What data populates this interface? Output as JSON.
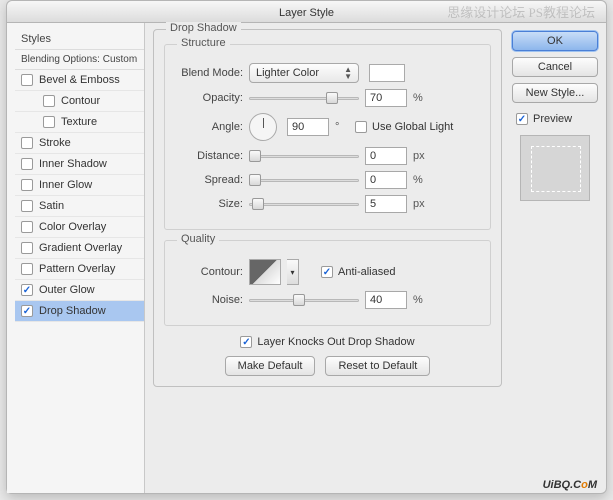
{
  "title": "Layer Style",
  "sidebar": {
    "header": "Styles",
    "sub": "Blending Options: Custom",
    "items": [
      {
        "label": "Bevel & Emboss",
        "checked": false
      },
      {
        "label": "Contour",
        "checked": false
      },
      {
        "label": "Texture",
        "checked": false
      },
      {
        "label": "Stroke",
        "checked": false
      },
      {
        "label": "Inner Shadow",
        "checked": false
      },
      {
        "label": "Inner Glow",
        "checked": false
      },
      {
        "label": "Satin",
        "checked": false
      },
      {
        "label": "Color Overlay",
        "checked": false
      },
      {
        "label": "Gradient Overlay",
        "checked": false
      },
      {
        "label": "Pattern Overlay",
        "checked": false
      },
      {
        "label": "Outer Glow",
        "checked": true
      },
      {
        "label": "Drop Shadow",
        "checked": true
      }
    ]
  },
  "panel": {
    "title": "Drop Shadow",
    "structure": {
      "legend": "Structure",
      "blend_mode_label": "Blend Mode:",
      "blend_mode_value": "Lighter Color",
      "opacity_label": "Opacity:",
      "opacity_value": "70",
      "opacity_unit": "%",
      "angle_label": "Angle:",
      "angle_value": "90",
      "angle_unit": "°",
      "global_light_label": "Use Global Light",
      "global_light_checked": false,
      "distance_label": "Distance:",
      "distance_value": "0",
      "distance_unit": "px",
      "spread_label": "Spread:",
      "spread_value": "0",
      "spread_unit": "%",
      "size_label": "Size:",
      "size_value": "5",
      "size_unit": "px"
    },
    "quality": {
      "legend": "Quality",
      "contour_label": "Contour:",
      "antialiased_label": "Anti-aliased",
      "antialiased_checked": true,
      "noise_label": "Noise:",
      "noise_value": "40",
      "noise_unit": "%"
    },
    "knockout_label": "Layer Knocks Out Drop Shadow",
    "knockout_checked": true,
    "make_default": "Make Default",
    "reset_default": "Reset to Default"
  },
  "buttons": {
    "ok": "OK",
    "cancel": "Cancel",
    "new_style": "New Style...",
    "preview": "Preview",
    "preview_checked": true
  },
  "watermark": {
    "top": "思缘设计论坛  PS教程论坛",
    "logo_a": "UiBQ.C",
    "logo_b": "o",
    "logo_c": "M"
  }
}
